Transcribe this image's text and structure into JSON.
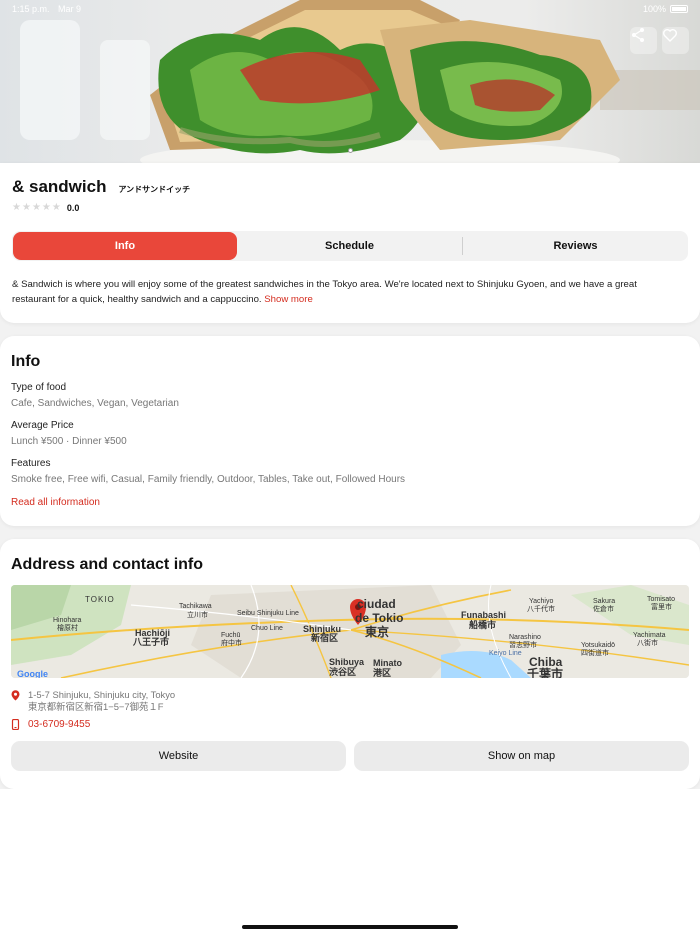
{
  "status_bar": {
    "time": "1:15 p.m.",
    "date": "Mar 9",
    "battery": "100%"
  },
  "hero": {
    "image_desc": "sandwich photo"
  },
  "restaurant": {
    "name": "& sandwich",
    "name_ja": "アンドサンドイッチ",
    "rating": "0.0"
  },
  "tabs": {
    "info": "Info",
    "schedule": "Schedule",
    "reviews": "Reviews"
  },
  "description": {
    "text": "& Sandwich is where you will enjoy some of the greatest sandwiches in the Tokyo area. We're located next to Shinjuku Gyoen, and we have a great restaurant for a quick, healthy sandwich and a cappuccino.",
    "show_more": "Show more"
  },
  "info_section": {
    "heading": "Info",
    "type_of_food_label": "Type of food",
    "type_of_food_value": "Cafe, Sandwiches, Vegan, Vegetarian",
    "average_price_label": "Average Price",
    "average_price_value": "Lunch ¥500 · Dinner ¥500",
    "features_label": "Features",
    "features_value": "Smoke free, Free wifi, Casual, Family friendly, Outdoor, Tables, Take out, Followed Hours",
    "read_all": "Read all information"
  },
  "contact_section": {
    "heading": "Address and contact info",
    "address_line1": "1-5-7 Shinjuku, Shinjuku city, Tokyo",
    "address_line2": "東京都新宿区新宿1−5−7御苑１F",
    "phone": "03-6709-9455",
    "website_button": "Website",
    "map_button": "Show on map"
  },
  "map_labels": {
    "tokio_left": "TOKIO",
    "hinohara": "Hinohara",
    "hinohara_ja": "檜原村",
    "hachioji": "Hachiōji",
    "hachioji_ja": "八王子市",
    "tachikawa": "Tachikawa",
    "tachikawa_ja": "立川市",
    "fuchu": "Fuchū",
    "fuchu_ja": "府中市",
    "chuo_line": "Chuo Line",
    "seibu": "Seibu Shinjuku Line",
    "shinjuku": "Shinjuku",
    "shinjuku_ja": "新宿区",
    "ciudad": "ciudad",
    "de_tokio": "de Tokio",
    "tokyo_ja": "東京",
    "shibuya": "Shibuya",
    "shibuya_ja": "渋谷区",
    "minato": "Minato",
    "minato_ja": "港区",
    "funabashi": "Funabashi",
    "funabashi_ja": "船橋市",
    "yachiyo": "Yachiyo",
    "yachiyo_ja": "八千代市",
    "sakura": "Sakura",
    "sakura_ja": "佐倉市",
    "tomisato": "Tomisato",
    "tomisato_ja": "富里市",
    "narashino": "Narashino",
    "narashino_ja": "習志野市",
    "yotsukaido": "Yotsukaidō",
    "yotsukaido_ja": "四街道市",
    "yachimata": "Yachimata",
    "yachimata_ja": "八街市",
    "chiba": "Chiba",
    "chiba_ja": "千葉市",
    "keiyo": "Keiyo Line",
    "google": "Google"
  },
  "colors": {
    "accent": "#e9473a",
    "link": "#d42c1f"
  }
}
